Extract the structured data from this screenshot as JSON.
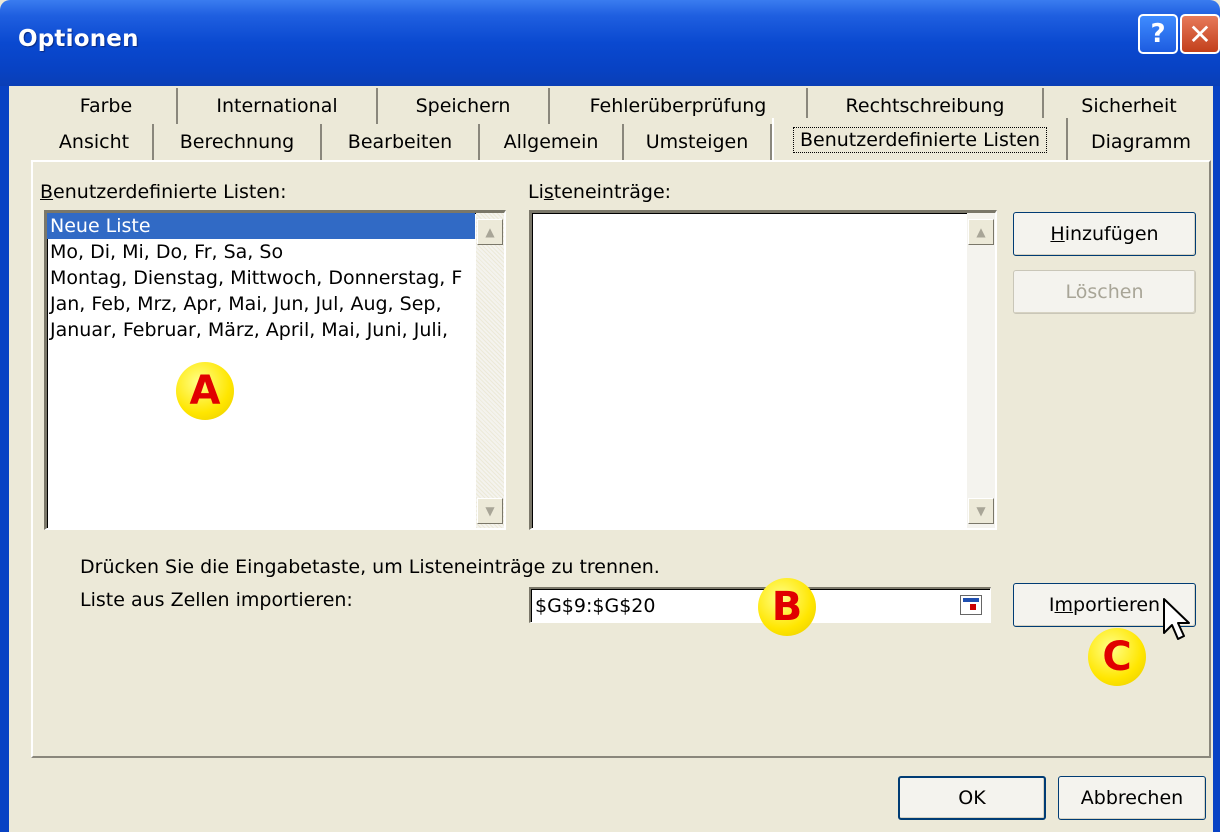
{
  "window": {
    "title": "Optionen",
    "help_label": "?",
    "close_label": "✕"
  },
  "tabs_row1": [
    "Farbe",
    "International",
    "Speichern",
    "Fehlerüberprüfung",
    "Rechtschreibung",
    "Sicherheit"
  ],
  "tabs_row2": [
    "Ansicht",
    "Berechnung",
    "Bearbeiten",
    "Allgemein",
    "Umsteigen",
    "Benutzerdefinierte Listen",
    "Diagramm"
  ],
  "active_tab": "Benutzerdefinierte Listen",
  "custom_lists": {
    "label_first": "B",
    "label_rest": "enutzerdefinierte Listen:",
    "items": [
      "Neue Liste",
      "Mo, Di, Mi, Do, Fr, Sa, So",
      "Montag, Dienstag, Mittwoch, Donnerstag, F",
      "Jan, Feb, Mrz, Apr, Mai, Jun, Jul, Aug, Sep,",
      "Januar, Februar, März, April, Mai, Juni, Juli,"
    ],
    "selected_index": 0
  },
  "entries": {
    "label_pre": "Li",
    "label_u": "s",
    "label_post": "teneinträge:"
  },
  "buttons": {
    "add_u": "H",
    "add_rest": "inzufügen",
    "delete": "Löschen",
    "import_pre": "I",
    "import_u": "m",
    "import_post": "portieren",
    "ok": "OK",
    "cancel": "Abbrechen"
  },
  "hint_text": "Drücken Sie die Eingabetaste, um Listeneinträge zu trennen.",
  "import_label": "Liste aus Zellen importieren:",
  "import_range_value": "$G$9:$G$20",
  "markers": {
    "a": "A",
    "b": "B",
    "c": "C"
  },
  "scroll_icons": {
    "up": "▲",
    "down": "▼"
  }
}
